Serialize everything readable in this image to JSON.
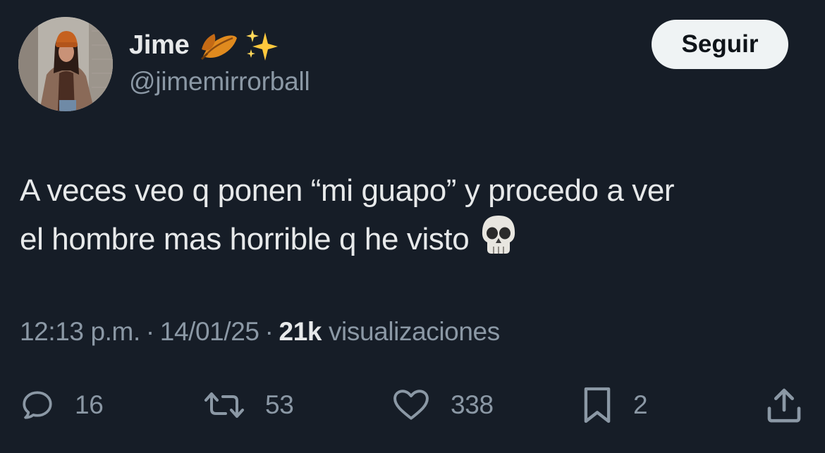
{
  "author": {
    "display_name": "Jime",
    "name_emojis": [
      "fallen-leaf-icon",
      "sparkles-icon"
    ],
    "handle": "@jimemirrorball"
  },
  "follow_button": {
    "label": "Seguir"
  },
  "tweet": {
    "text_line_1": "A veces veo q ponen “mi guapo” y procedo a ver",
    "text_line_2": "el hombre mas horrible q he visto",
    "trailing_emoji": "skull-icon"
  },
  "meta": {
    "time": "12:13 p.m.",
    "separator": "·",
    "date": "14/01/25",
    "views_count": "21k",
    "views_label": "visualizaciones"
  },
  "actions": {
    "replies": "16",
    "reposts": "53",
    "likes": "338",
    "bookmarks": "2"
  },
  "colors": {
    "background": "#161d27",
    "primary_text": "#e7e9ea",
    "secondary_text": "#8b98a5",
    "button_bg": "#eff3f4",
    "button_text": "#0f1419"
  }
}
